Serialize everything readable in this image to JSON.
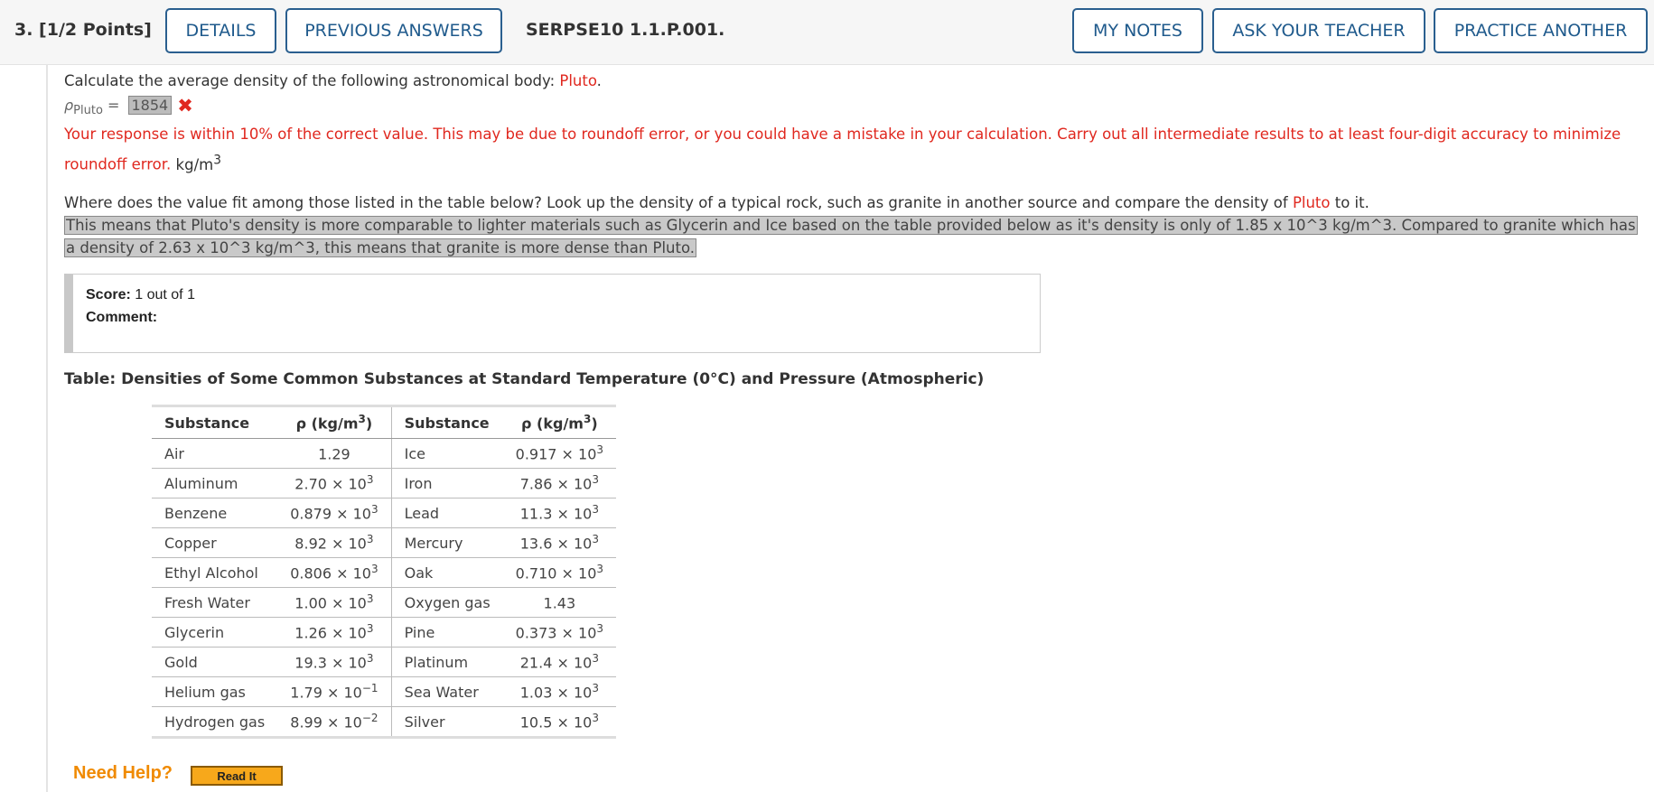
{
  "header": {
    "question_label": "3.  [1/2 Points]",
    "details_btn": "DETAILS",
    "previous_btn": "PREVIOUS ANSWERS",
    "code": "SERPSE10 1.1.P.001.",
    "notes_btn": "MY NOTES",
    "ask_btn": "ASK YOUR TEACHER",
    "practice_btn": "PRACTICE ANOTHER"
  },
  "question": {
    "prompt": "Calculate the average density of the following astronomical body: ",
    "body": "Pluto",
    "rho_symbol": "ρ",
    "rho_sub": "Pluto",
    "equals": "=",
    "answer": "1854",
    "feedback": "Your response is within 10% of the correct value. This may be due to roundoff error, or you could have a mistake in your calculation. Carry out all intermediate results to at least four-digit accuracy to minimize roundoff error.",
    "unit": "kg/m",
    "unit_exp": "3"
  },
  "followup": {
    "prompt_before": "Where does the value fit among those listed in the table below? Look up the density of a typical rock, such as granite in another source and compare the density of ",
    "body": "Pluto",
    "prompt_after": " to it.",
    "response": "This means that Pluto's density is more comparable to lighter materials such as Glycerin and Ice based on the table provided below as it's density is only of 1.85 x 10^3 kg/m^3. Compared to granite which has a density of 2.63 x 10^3 kg/m^3, this means that granite is more dense than Pluto."
  },
  "score": {
    "score_label": "Score:",
    "score_value": " 1 out of 1",
    "comment_label": "Comment:"
  },
  "table": {
    "caption": "Table: Densities of Some Common Substances at Standard Temperature (0°C) and Pressure (Atmospheric)",
    "col_substance": "Substance",
    "col_rho": "ρ (kg/m",
    "col_rho_exp": "3",
    "col_rho_close": ")",
    "rows": [
      {
        "a": "Air",
        "av": "1.29",
        "ae": "",
        "b": "Ice",
        "bv": "0.917 × 10",
        "be": "3"
      },
      {
        "a": "Aluminum",
        "av": "2.70 × 10",
        "ae": "3",
        "b": "Iron",
        "bv": "7.86 × 10",
        "be": "3"
      },
      {
        "a": "Benzene",
        "av": "0.879 × 10",
        "ae": "3",
        "b": "Lead",
        "bv": "11.3 × 10",
        "be": "3"
      },
      {
        "a": "Copper",
        "av": "8.92 × 10",
        "ae": "3",
        "b": "Mercury",
        "bv": "13.6 × 10",
        "be": "3"
      },
      {
        "a": "Ethyl Alcohol",
        "av": "0.806 × 10",
        "ae": "3",
        "b": "Oak",
        "bv": "0.710 × 10",
        "be": "3"
      },
      {
        "a": "Fresh Water",
        "av": "1.00 × 10",
        "ae": "3",
        "b": "Oxygen gas",
        "bv": "1.43",
        "be": ""
      },
      {
        "a": "Glycerin",
        "av": "1.26 × 10",
        "ae": "3",
        "b": "Pine",
        "bv": "0.373 × 10",
        "be": "3"
      },
      {
        "a": "Gold",
        "av": "19.3 × 10",
        "ae": "3",
        "b": "Platinum",
        "bv": "21.4 × 10",
        "be": "3"
      },
      {
        "a": "Helium gas",
        "av": "1.79 × 10",
        "ae": "−1",
        "b": "Sea Water",
        "bv": "1.03 × 10",
        "be": "3"
      },
      {
        "a": "Hydrogen gas",
        "av": "8.99 × 10",
        "ae": "−2",
        "b": "Silver",
        "bv": "10.5 × 10",
        "be": "3"
      }
    ]
  },
  "help": {
    "label": "Need Help?",
    "read_btn": "Read It"
  },
  "colors": {
    "accent": "#1f5a8c",
    "error_red": "#e0281f",
    "help_orange": "#f08a00"
  }
}
